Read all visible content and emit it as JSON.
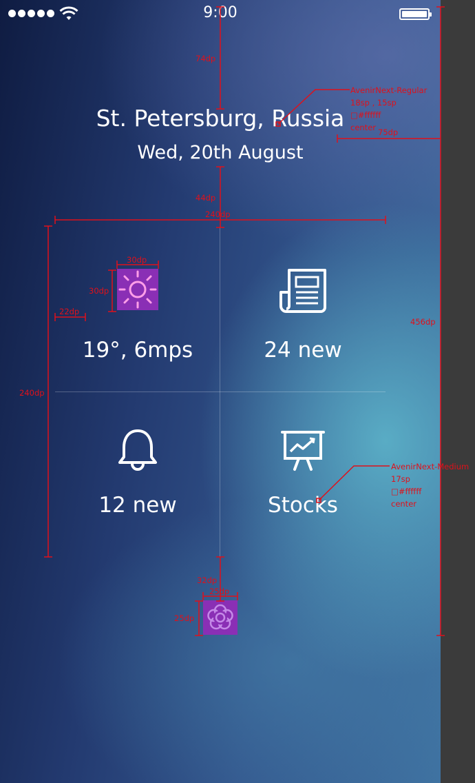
{
  "status_bar": {
    "time": "9:00",
    "signal_bars": 5,
    "wifi_icon": "wifi-icon",
    "battery_level": 1.0
  },
  "header": {
    "city": "St. Petersburg, Russia",
    "date": "Wed, 20th August"
  },
  "tiles": [
    {
      "id": "weather",
      "icon": "sun-icon",
      "label": "19°, 6mps"
    },
    {
      "id": "news",
      "icon": "newspaper-icon",
      "label": "24 new"
    },
    {
      "id": "notifications",
      "icon": "bell-icon",
      "label": "12 new"
    },
    {
      "id": "stocks",
      "icon": "presentation-chart-icon",
      "label": "Stocks"
    }
  ],
  "settings": {
    "icon": "flower-settings-icon"
  },
  "annotations": {
    "gap_status_to_title": "74dp",
    "title_font": "AvenirNext-Regular",
    "title_sizes": "18sp , 15sp",
    "title_color": "□#ffffff",
    "title_align": "center",
    "side_margin": "75dp",
    "gap_title_to_grid": "44dp",
    "grid_width": "240dp",
    "content_height": "456dp",
    "icon_width": "30dp",
    "icon_height": "30dp",
    "label_margin": "22dp",
    "grid_height": "240dp",
    "label_font": "AvenirNext-Medium",
    "label_size": "17sp",
    "label_color": "□#ffffff",
    "label_align": "center",
    "gap_grid_to_settings": "32dp",
    "settings_width": "25dp",
    "settings_height": "25dp"
  },
  "colors": {
    "annotation": "#e0101a",
    "accent_purple": "#8a2fb5",
    "text": "#ffffff"
  }
}
